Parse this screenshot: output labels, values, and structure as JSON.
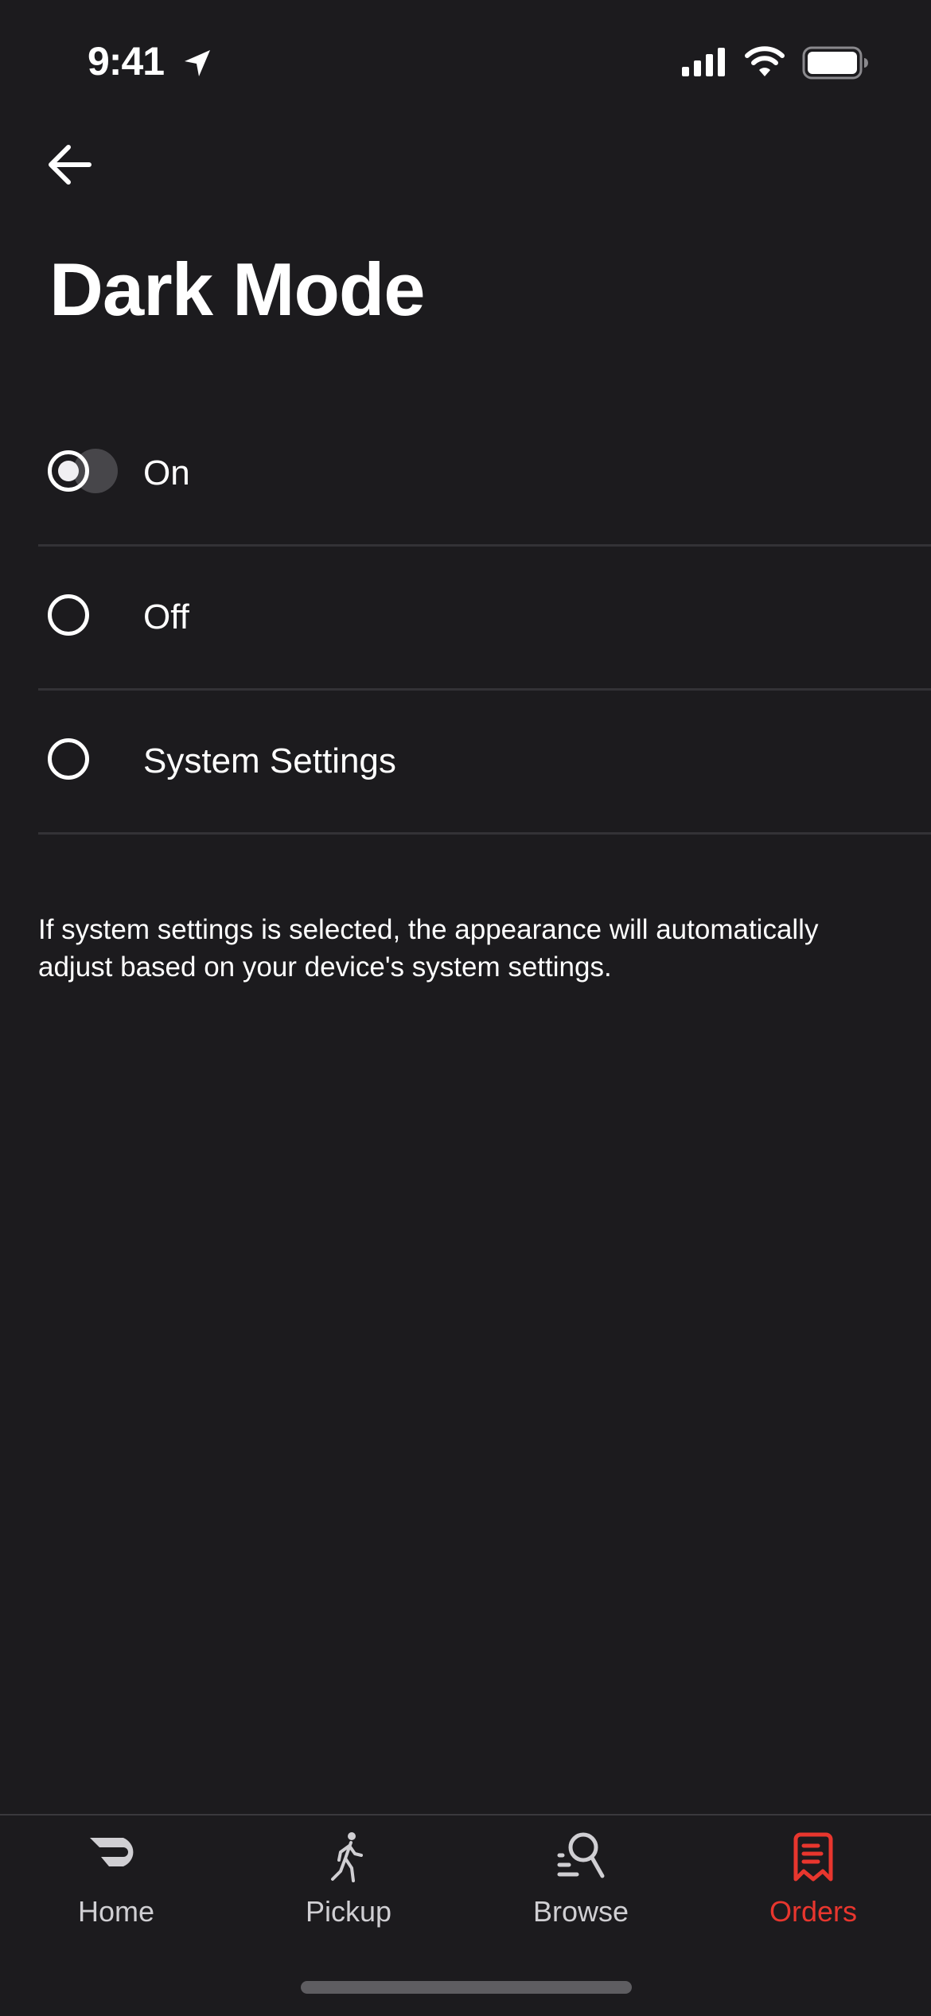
{
  "status_bar": {
    "time": "9:41",
    "icons": [
      "location-arrow-icon",
      "cellular-signal-icon",
      "wifi-icon",
      "battery-icon"
    ]
  },
  "header": {
    "back_icon": "arrow-left-icon",
    "title": "Dark Mode"
  },
  "options": [
    {
      "label": "On",
      "selected": true
    },
    {
      "label": "Off",
      "selected": false
    },
    {
      "label": "System Settings",
      "selected": false
    }
  ],
  "helper_text": "If system settings is selected, the appearance will automatically adjust based on your device's system settings.",
  "tab_bar": {
    "tabs": [
      {
        "label": "Home",
        "icon": "doordash-logo-icon",
        "active": false
      },
      {
        "label": "Pickup",
        "icon": "walking-person-icon",
        "active": false
      },
      {
        "label": "Browse",
        "icon": "browse-search-icon",
        "active": false
      },
      {
        "label": "Orders",
        "icon": "receipt-icon",
        "active": true
      }
    ],
    "active_color": "#e8362e",
    "inactive_color": "#d0cfd3"
  },
  "theme": {
    "background": "#1c1b1e",
    "divider": "#333236"
  }
}
